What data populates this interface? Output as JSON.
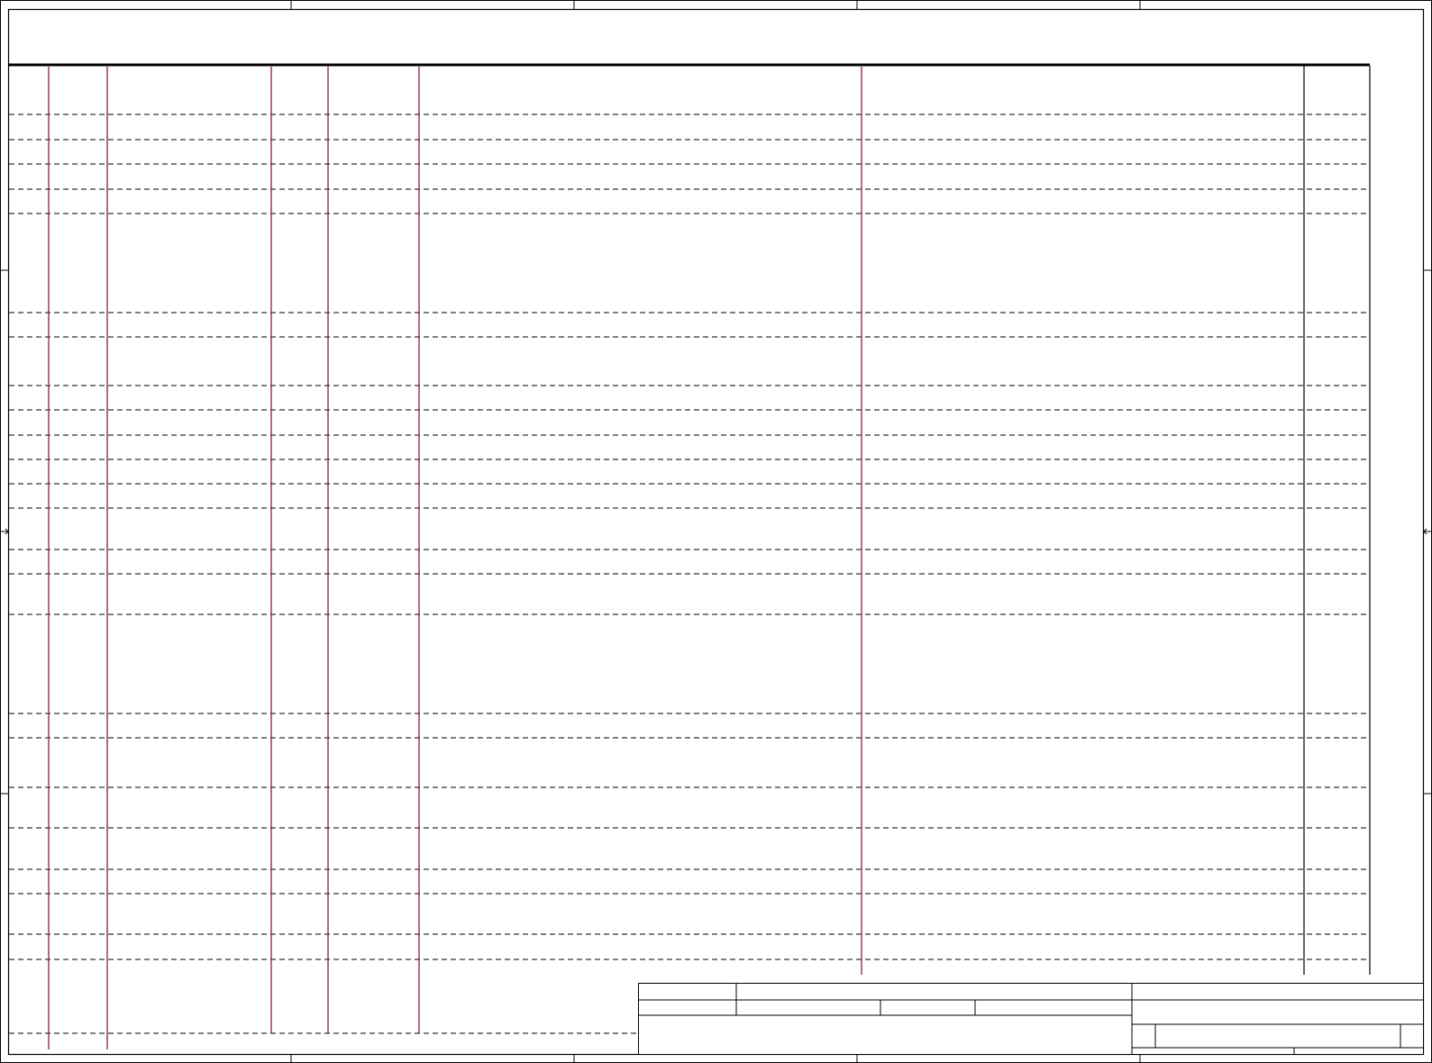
{
  "document": {
    "kind": "blank-schematic-sheet",
    "colors": {
      "frame": "#000000",
      "column_rule": "#8b1a4a",
      "row_dash": "#000000",
      "background": "#ffffff"
    },
    "row_count": 25,
    "column_rule_count": 6,
    "title_block_text": []
  }
}
